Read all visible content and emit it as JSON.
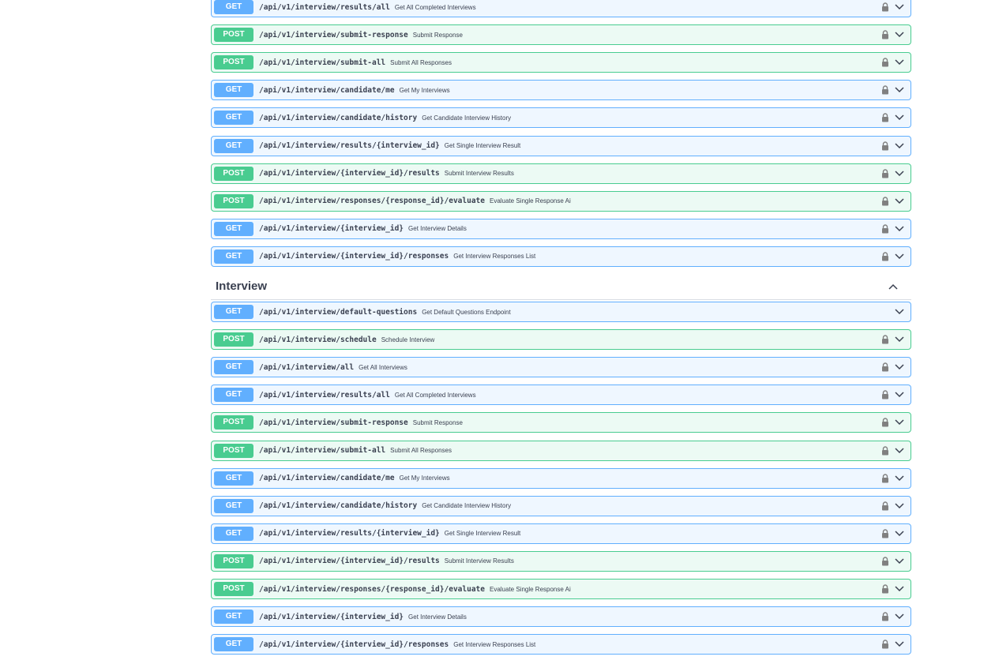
{
  "colors": {
    "get": "#61affe",
    "post": "#49cc90",
    "text": "#3b4151",
    "icon": "#808080"
  },
  "section_above": {
    "operations": [
      {
        "method": "GET",
        "path": "/api/v1/interview/results/all",
        "summary": "Get All Completed Interviews",
        "locked": true
      },
      {
        "method": "POST",
        "path": "/api/v1/interview/submit-response",
        "summary": "Submit Response",
        "locked": true
      },
      {
        "method": "POST",
        "path": "/api/v1/interview/submit-all",
        "summary": "Submit All Responses",
        "locked": true
      },
      {
        "method": "GET",
        "path": "/api/v1/interview/candidate/me",
        "summary": "Get My Interviews",
        "locked": true
      },
      {
        "method": "GET",
        "path": "/api/v1/interview/candidate/history",
        "summary": "Get Candidate Interview History",
        "locked": true
      },
      {
        "method": "GET",
        "path": "/api/v1/interview/results/{interview_id}",
        "summary": "Get Single Interview Result",
        "locked": true
      },
      {
        "method": "POST",
        "path": "/api/v1/interview/{interview_id}/results",
        "summary": "Submit Interview Results",
        "locked": true
      },
      {
        "method": "POST",
        "path": "/api/v1/interview/responses/{response_id}/evaluate",
        "summary": "Evaluate Single Response Ai",
        "locked": true
      },
      {
        "method": "GET",
        "path": "/api/v1/interview/{interview_id}",
        "summary": "Get Interview Details",
        "locked": true
      },
      {
        "method": "GET",
        "path": "/api/v1/interview/{interview_id}/responses",
        "summary": "Get Interview Responses List",
        "locked": true
      }
    ]
  },
  "interview_section": {
    "title": "Interview",
    "toggle_icon": "chevron-up-icon",
    "operations": [
      {
        "method": "GET",
        "path": "/api/v1/interview/default-questions",
        "summary": "Get Default Questions Endpoint",
        "locked": false
      },
      {
        "method": "POST",
        "path": "/api/v1/interview/schedule",
        "summary": "Schedule Interview",
        "locked": true
      },
      {
        "method": "GET",
        "path": "/api/v1/interview/all",
        "summary": "Get All Interviews",
        "locked": true
      },
      {
        "method": "GET",
        "path": "/api/v1/interview/results/all",
        "summary": "Get All Completed Interviews",
        "locked": true
      },
      {
        "method": "POST",
        "path": "/api/v1/interview/submit-response",
        "summary": "Submit Response",
        "locked": true
      },
      {
        "method": "POST",
        "path": "/api/v1/interview/submit-all",
        "summary": "Submit All Responses",
        "locked": true
      },
      {
        "method": "GET",
        "path": "/api/v1/interview/candidate/me",
        "summary": "Get My Interviews",
        "locked": true
      },
      {
        "method": "GET",
        "path": "/api/v1/interview/candidate/history",
        "summary": "Get Candidate Interview History",
        "locked": true
      },
      {
        "method": "GET",
        "path": "/api/v1/interview/results/{interview_id}",
        "summary": "Get Single Interview Result",
        "locked": true
      },
      {
        "method": "POST",
        "path": "/api/v1/interview/{interview_id}/results",
        "summary": "Submit Interview Results",
        "locked": true
      },
      {
        "method": "POST",
        "path": "/api/v1/interview/responses/{response_id}/evaluate",
        "summary": "Evaluate Single Response Ai",
        "locked": true
      },
      {
        "method": "GET",
        "path": "/api/v1/interview/{interview_id}",
        "summary": "Get Interview Details",
        "locked": true
      },
      {
        "method": "GET",
        "path": "/api/v1/interview/{interview_id}/responses",
        "summary": "Get Interview Responses List",
        "locked": true
      }
    ]
  }
}
